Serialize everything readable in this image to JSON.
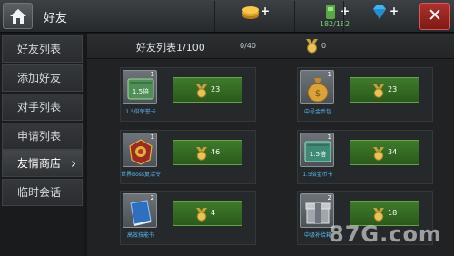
{
  "header": {
    "title": "好友",
    "resources": [
      {
        "name": "gold",
        "icon": "gold-coins-icon",
        "plus": "+",
        "count": ""
      },
      {
        "name": "stamina",
        "icon": "stamina-bottle-icon",
        "plus": "+",
        "count": "182/182"
      },
      {
        "name": "diamond",
        "icon": "diamond-icon",
        "plus": "+",
        "count": ""
      }
    ],
    "close_label": "✕"
  },
  "sidebar": {
    "items": [
      {
        "label": "好友列表",
        "active": false
      },
      {
        "label": "添加好友",
        "active": false
      },
      {
        "label": "对手列表",
        "active": false
      },
      {
        "label": "申请列表",
        "active": false
      },
      {
        "label": "友情商店",
        "active": true,
        "arrow": "›"
      },
      {
        "label": "临时会话",
        "active": false
      }
    ]
  },
  "list_header": {
    "title": "好友列表1/100",
    "count": "0/40",
    "points": "0"
  },
  "shop_items": [
    {
      "name": "1.5倍荣誉卡",
      "qty": "1",
      "price": "23",
      "art": "honor-card-icon",
      "art_label": "1.5倍"
    },
    {
      "name": "中号金币包",
      "qty": "1",
      "price": "23",
      "art": "coin-bag-icon"
    },
    {
      "name": "世界Boss复活令",
      "qty": "1",
      "price": "46",
      "art": "boss-revive-token-icon"
    },
    {
      "name": "1.5倍金币卡",
      "qty": "1",
      "price": "34",
      "art": "gold-card-icon",
      "art_label": "1.5倍"
    },
    {
      "name": "高效技能书",
      "qty": "2",
      "price": "4",
      "art": "skill-book-icon"
    },
    {
      "name": "中级补给箱",
      "qty": "2",
      "price": "18",
      "art": "supply-box-icon"
    }
  ],
  "watermark": "87G.com",
  "colors": {
    "accent_green": "#3f7a2a",
    "item_name_blue": "#58b7f2",
    "close_red": "#b0302c",
    "stamina_green": "#79d27a"
  }
}
